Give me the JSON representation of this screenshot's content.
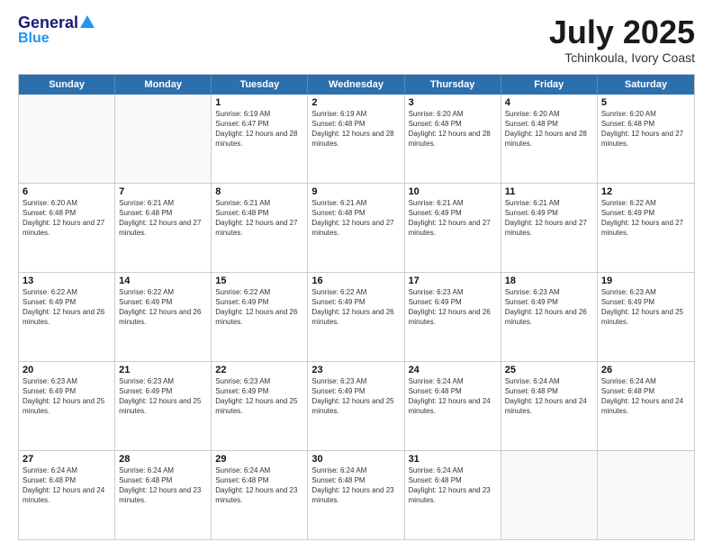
{
  "logo": {
    "general": "General",
    "blue": "Blue"
  },
  "title": "July 2025",
  "subtitle": "Tchinkoula, Ivory Coast",
  "days": [
    "Sunday",
    "Monday",
    "Tuesday",
    "Wednesday",
    "Thursday",
    "Friday",
    "Saturday"
  ],
  "weeks": [
    [
      {
        "day": "",
        "info": ""
      },
      {
        "day": "",
        "info": ""
      },
      {
        "day": "1",
        "info": "Sunrise: 6:19 AM\nSunset: 6:47 PM\nDaylight: 12 hours and 28 minutes."
      },
      {
        "day": "2",
        "info": "Sunrise: 6:19 AM\nSunset: 6:48 PM\nDaylight: 12 hours and 28 minutes."
      },
      {
        "day": "3",
        "info": "Sunrise: 6:20 AM\nSunset: 6:48 PM\nDaylight: 12 hours and 28 minutes."
      },
      {
        "day": "4",
        "info": "Sunrise: 6:20 AM\nSunset: 6:48 PM\nDaylight: 12 hours and 28 minutes."
      },
      {
        "day": "5",
        "info": "Sunrise: 6:20 AM\nSunset: 6:48 PM\nDaylight: 12 hours and 27 minutes."
      }
    ],
    [
      {
        "day": "6",
        "info": "Sunrise: 6:20 AM\nSunset: 6:48 PM\nDaylight: 12 hours and 27 minutes."
      },
      {
        "day": "7",
        "info": "Sunrise: 6:21 AM\nSunset: 6:48 PM\nDaylight: 12 hours and 27 minutes."
      },
      {
        "day": "8",
        "info": "Sunrise: 6:21 AM\nSunset: 6:48 PM\nDaylight: 12 hours and 27 minutes."
      },
      {
        "day": "9",
        "info": "Sunrise: 6:21 AM\nSunset: 6:48 PM\nDaylight: 12 hours and 27 minutes."
      },
      {
        "day": "10",
        "info": "Sunrise: 6:21 AM\nSunset: 6:49 PM\nDaylight: 12 hours and 27 minutes."
      },
      {
        "day": "11",
        "info": "Sunrise: 6:21 AM\nSunset: 6:49 PM\nDaylight: 12 hours and 27 minutes."
      },
      {
        "day": "12",
        "info": "Sunrise: 6:22 AM\nSunset: 6:49 PM\nDaylight: 12 hours and 27 minutes."
      }
    ],
    [
      {
        "day": "13",
        "info": "Sunrise: 6:22 AM\nSunset: 6:49 PM\nDaylight: 12 hours and 26 minutes."
      },
      {
        "day": "14",
        "info": "Sunrise: 6:22 AM\nSunset: 6:49 PM\nDaylight: 12 hours and 26 minutes."
      },
      {
        "day": "15",
        "info": "Sunrise: 6:22 AM\nSunset: 6:49 PM\nDaylight: 12 hours and 26 minutes."
      },
      {
        "day": "16",
        "info": "Sunrise: 6:22 AM\nSunset: 6:49 PM\nDaylight: 12 hours and 26 minutes."
      },
      {
        "day": "17",
        "info": "Sunrise: 6:23 AM\nSunset: 6:49 PM\nDaylight: 12 hours and 26 minutes."
      },
      {
        "day": "18",
        "info": "Sunrise: 6:23 AM\nSunset: 6:49 PM\nDaylight: 12 hours and 26 minutes."
      },
      {
        "day": "19",
        "info": "Sunrise: 6:23 AM\nSunset: 6:49 PM\nDaylight: 12 hours and 25 minutes."
      }
    ],
    [
      {
        "day": "20",
        "info": "Sunrise: 6:23 AM\nSunset: 6:49 PM\nDaylight: 12 hours and 25 minutes."
      },
      {
        "day": "21",
        "info": "Sunrise: 6:23 AM\nSunset: 6:49 PM\nDaylight: 12 hours and 25 minutes."
      },
      {
        "day": "22",
        "info": "Sunrise: 6:23 AM\nSunset: 6:49 PM\nDaylight: 12 hours and 25 minutes."
      },
      {
        "day": "23",
        "info": "Sunrise: 6:23 AM\nSunset: 6:49 PM\nDaylight: 12 hours and 25 minutes."
      },
      {
        "day": "24",
        "info": "Sunrise: 6:24 AM\nSunset: 6:48 PM\nDaylight: 12 hours and 24 minutes."
      },
      {
        "day": "25",
        "info": "Sunrise: 6:24 AM\nSunset: 6:48 PM\nDaylight: 12 hours and 24 minutes."
      },
      {
        "day": "26",
        "info": "Sunrise: 6:24 AM\nSunset: 6:48 PM\nDaylight: 12 hours and 24 minutes."
      }
    ],
    [
      {
        "day": "27",
        "info": "Sunrise: 6:24 AM\nSunset: 6:48 PM\nDaylight: 12 hours and 24 minutes."
      },
      {
        "day": "28",
        "info": "Sunrise: 6:24 AM\nSunset: 6:48 PM\nDaylight: 12 hours and 23 minutes."
      },
      {
        "day": "29",
        "info": "Sunrise: 6:24 AM\nSunset: 6:48 PM\nDaylight: 12 hours and 23 minutes."
      },
      {
        "day": "30",
        "info": "Sunrise: 6:24 AM\nSunset: 6:48 PM\nDaylight: 12 hours and 23 minutes."
      },
      {
        "day": "31",
        "info": "Sunrise: 6:24 AM\nSunset: 6:48 PM\nDaylight: 12 hours and 23 minutes."
      },
      {
        "day": "",
        "info": ""
      },
      {
        "day": "",
        "info": ""
      }
    ]
  ]
}
